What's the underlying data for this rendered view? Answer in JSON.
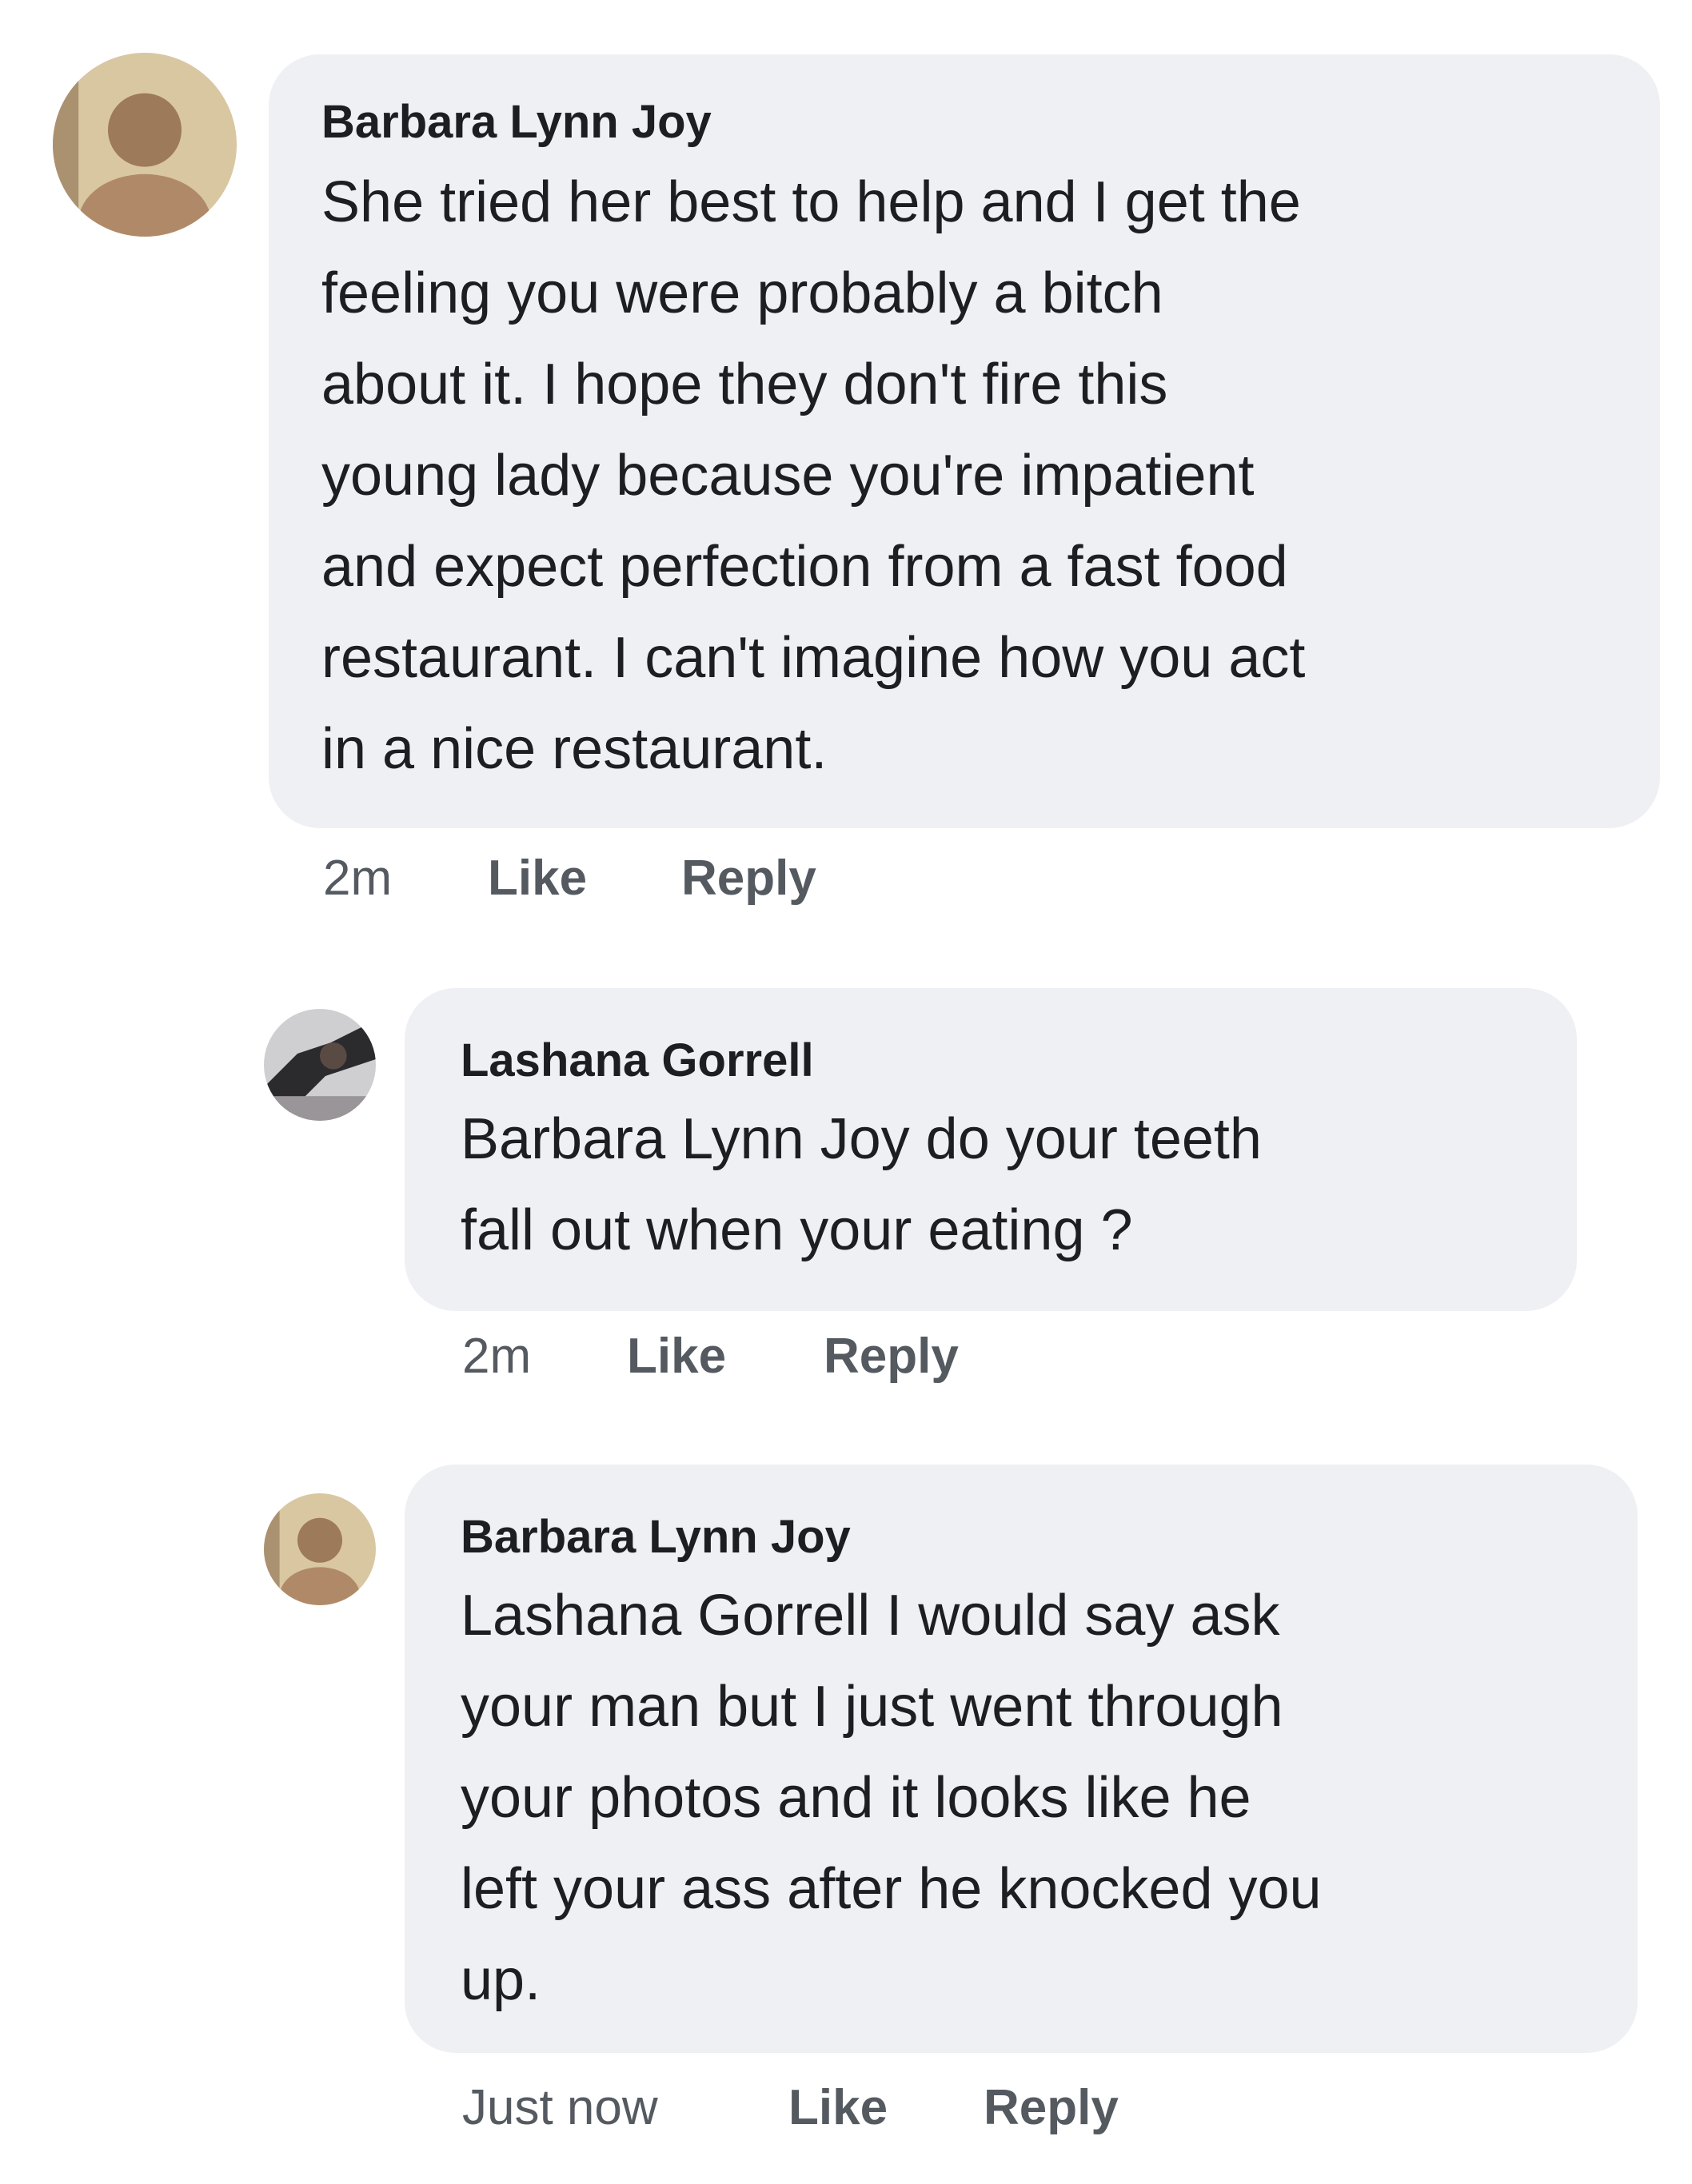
{
  "comments": [
    {
      "author": "Barbara Lynn Joy",
      "lines": [
        "She tried her best to help and I get the",
        "feeling you were probably a bitch",
        "about it. I hope they don't fire this",
        "young lady because you're impatient",
        "and expect perfection from a fast food",
        "restaurant. I can't imagine how you act",
        "in a nice restaurant."
      ],
      "time": "2m",
      "like_label": "Like",
      "reply_label": "Reply",
      "avatar_icon": "user-photo-icon"
    },
    {
      "author": "Lashana Gorrell",
      "lines": [
        "Barbara Lynn Joy  do your teeth",
        "fall out when your eating ?"
      ],
      "time": "2m",
      "like_label": "Like",
      "reply_label": "Reply",
      "avatar_icon": "user-photo-icon"
    },
    {
      "author": "Barbara Lynn Joy",
      "lines": [
        "Lashana Gorrell  I would say ask",
        "your man but I just went through",
        "your photos and it looks like he",
        "left your ass after he knocked you",
        "up."
      ],
      "time": "Just now",
      "like_label": "Like",
      "reply_label": "Reply",
      "avatar_icon": "user-photo-icon"
    }
  ],
  "colors": {
    "bubble": "#eff0f4",
    "text": "#1c1e21",
    "meta": "#555a61"
  }
}
